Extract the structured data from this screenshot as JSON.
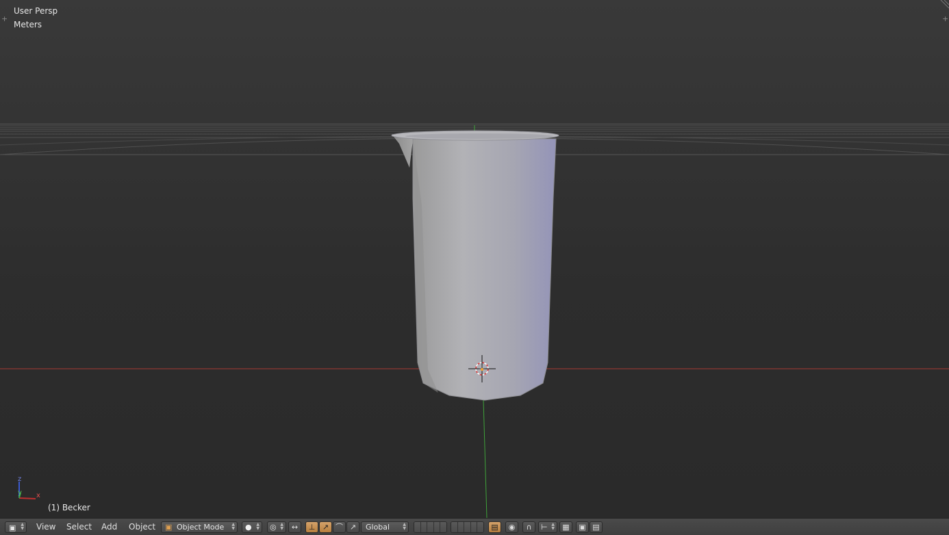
{
  "viewport": {
    "view_label": "User Persp",
    "units_label": "Meters",
    "active_object_label": "(1) Becker"
  },
  "axis_gizmo": {
    "z": "z",
    "y": "y",
    "x": "x"
  },
  "header": {
    "menus": [
      "View",
      "Select",
      "Add",
      "Object"
    ],
    "mode": "Object Mode",
    "transform_orientation": "Global"
  },
  "colors": {
    "x_axis": "#a83a34",
    "y_axis": "#3fa33a",
    "active_toggle": "#d4a26a"
  },
  "icons": {
    "editor_type": "cube-icon",
    "viewport_shading": "sphere-icon",
    "pivot_point": "pivot-icon",
    "manipulator": "manipulator-icon",
    "snap": "magnet-icon",
    "render": "camera-icon",
    "animation_render": "clapper-icon"
  }
}
